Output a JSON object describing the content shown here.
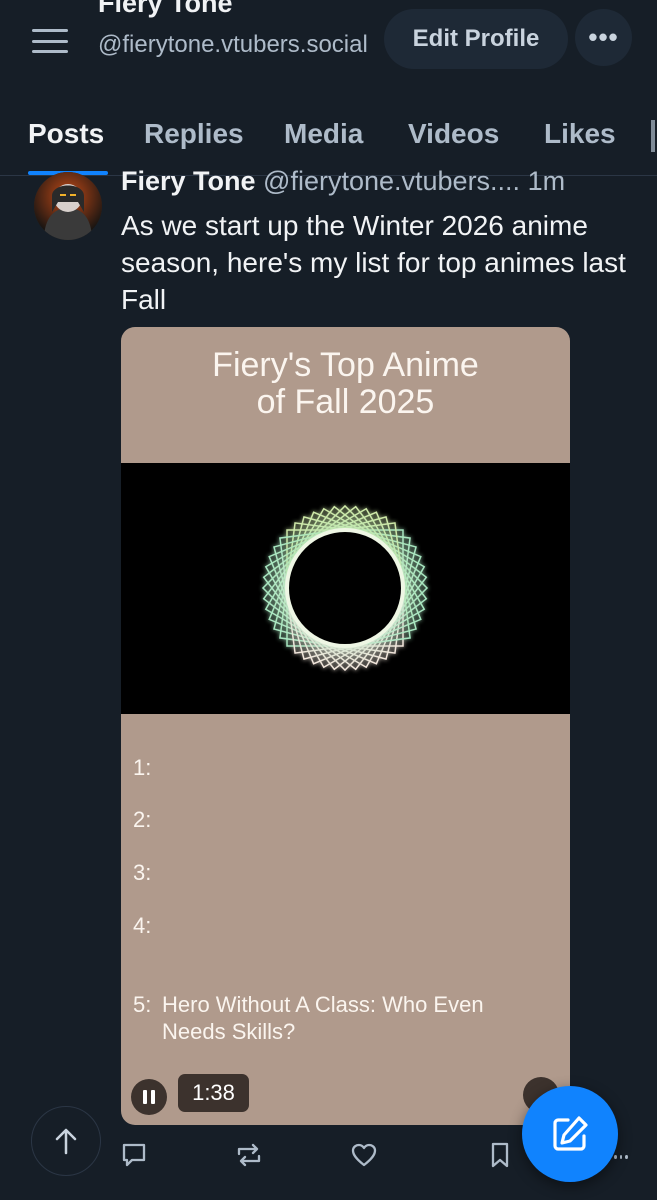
{
  "profile": {
    "name": "Fiery Tone",
    "handle": "@fierytone.vtubers.social",
    "edit_label": "Edit Profile",
    "more_label": "•••"
  },
  "tabs": [
    {
      "label": "Posts",
      "active": true
    },
    {
      "label": "Replies",
      "active": false
    },
    {
      "label": "Media",
      "active": false
    },
    {
      "label": "Videos",
      "active": false
    },
    {
      "label": "Likes",
      "active": false
    }
  ],
  "post": {
    "author_name": "Fiery Tone",
    "author_handle": "@fierytone.vtubers....",
    "time": "1m",
    "text": "As we start up the Winter 2026 anime season, here's my list for top animes last Fall",
    "video": {
      "title_line1": "Fiery's Top Anime",
      "title_line2": "of Fall 2025",
      "ranks": [
        {
          "num": "1:",
          "title": ""
        },
        {
          "num": "2:",
          "title": ""
        },
        {
          "num": "3:",
          "title": ""
        },
        {
          "num": "4:",
          "title": ""
        },
        {
          "num": "5:",
          "title": "Hero Without A Class: Who Even Needs Skills?"
        }
      ],
      "time_remaining": "1:38",
      "colors": {
        "background": "#b09a8c",
        "text": "#fbf5ef"
      }
    }
  },
  "icons": {
    "menu": "hamburger-icon",
    "scroll_top": "arrow-up-icon",
    "reply": "speech-bubble-icon",
    "repost": "repost-icon",
    "like": "heart-icon",
    "bookmark": "bookmark-icon",
    "compose": "pencil-square-icon"
  },
  "colors": {
    "accent": "#1083fe",
    "background": "#161e27",
    "muted": "#aebbc9"
  }
}
